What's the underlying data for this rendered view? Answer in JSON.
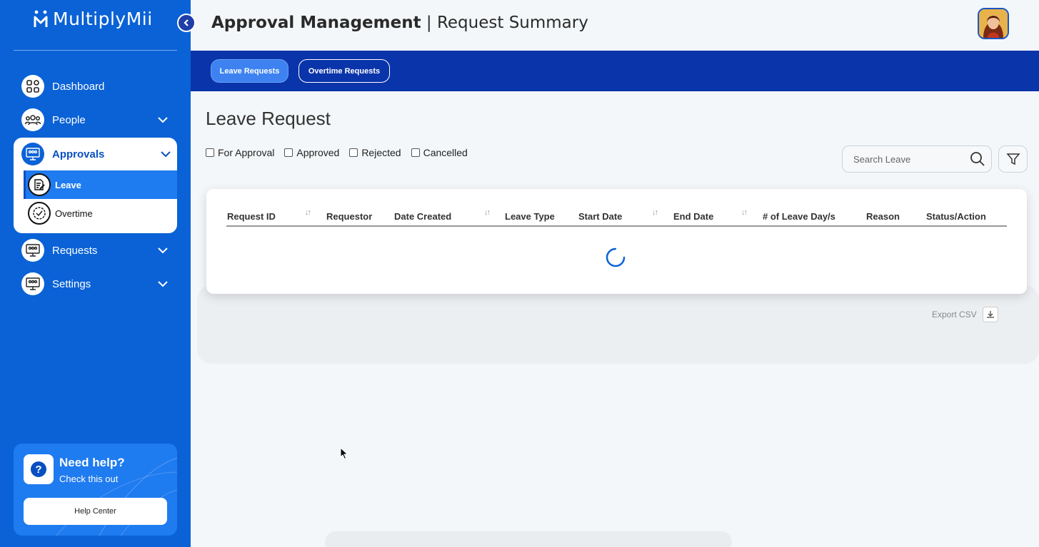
{
  "app": {
    "logo_text": "MultiplyMii"
  },
  "sidebar": {
    "items": [
      {
        "label": "Dashboard",
        "icon": "grid-icon"
      },
      {
        "label": "People",
        "icon": "people-icon"
      },
      {
        "label": "Approvals",
        "icon": "approvals-icon",
        "expanded": true
      },
      {
        "label": "Requests",
        "icon": "requests-icon"
      },
      {
        "label": "Settings",
        "icon": "settings-icon"
      }
    ],
    "approvals_sub": [
      {
        "label": "Leave",
        "active": true
      },
      {
        "label": "Overtime",
        "active": false
      }
    ],
    "help": {
      "title": "Need help?",
      "subtitle": "Check this out",
      "button": "Help Center"
    }
  },
  "header": {
    "title_bold": "Approval Management",
    "separator": "|",
    "title_rest": "Request Summary"
  },
  "tabs": [
    {
      "label": "Leave Requests",
      "active": true
    },
    {
      "label": "Overtime Requests",
      "active": false
    }
  ],
  "main": {
    "title": "Leave Request",
    "filters": [
      "For Approval",
      "Approved",
      "Rejected",
      "Cancelled"
    ],
    "search_placeholder": "Search Leave",
    "columns": [
      "Request ID",
      "Requestor",
      "Date Created",
      "Leave Type",
      "Start Date",
      "End Date",
      "# of Leave Day/s",
      "Reason",
      "Status/Action"
    ],
    "sort_glyph": "↓↑",
    "export_label": "Export CSV"
  },
  "colors": {
    "sidebar": "#0a62d6",
    "tab_bar": "#0a34aa",
    "active": "#1f7bf0"
  }
}
